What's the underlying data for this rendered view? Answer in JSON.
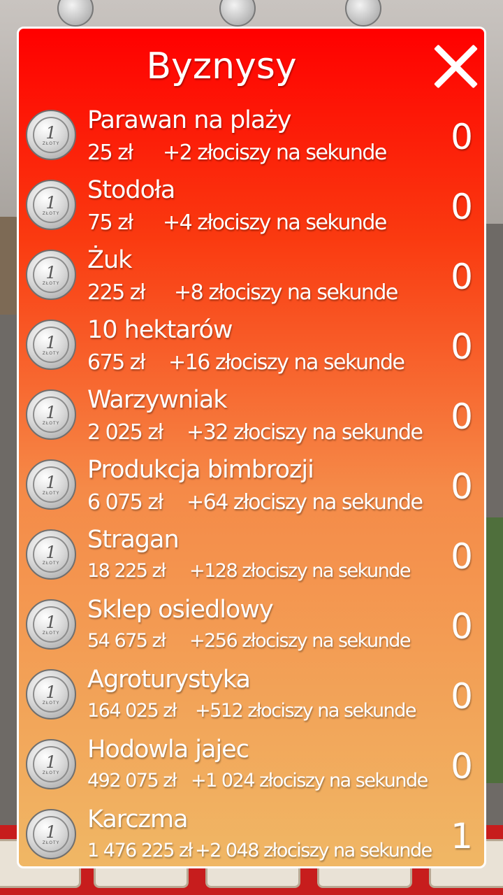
{
  "dialog": {
    "title": "Byznysy",
    "close_icon": "close-icon"
  },
  "coin_label": {
    "num": "1",
    "word": "ZŁOTY"
  },
  "businesses": [
    {
      "name": "Parawan na plaży",
      "price": "25 zł",
      "gain": "+2 złociszy na sekunde",
      "count": "0"
    },
    {
      "name": "Stodoła",
      "price": "75 zł",
      "gain": "+4 złociszy na sekunde",
      "count": "0"
    },
    {
      "name": "Żuk",
      "price": "225 zł",
      "gain": "+8 złociszy na sekunde",
      "count": "0"
    },
    {
      "name": "10 hektarów",
      "price": "675 zł",
      "gain": "+16 złociszy na sekunde",
      "count": "0"
    },
    {
      "name": "Warzywniak",
      "price": "2 025 zł",
      "gain": "+32 złociszy na sekunde",
      "count": "0"
    },
    {
      "name": "Produkcja bimbrozji",
      "price": "6 075 zł",
      "gain": "+64 złociszy na sekunde",
      "count": "0"
    },
    {
      "name": "Stragan",
      "price": "18 225 zł",
      "gain": "+128 złociszy na sekunde",
      "count": "0"
    },
    {
      "name": "Sklep osiedlowy",
      "price": "54 675 zł",
      "gain": "+256 złociszy na sekunde",
      "count": "0"
    },
    {
      "name": "Agroturystyka",
      "price": "164 025 zł",
      "gain": "+512 złociszy na sekunde",
      "count": "0"
    },
    {
      "name": "Hodowla jajec",
      "price": "492 075 zł",
      "gain": "+1 024 złociszy na sekunde",
      "count": "0"
    },
    {
      "name": "Karczma",
      "price": "1 476 225 zł",
      "gain": "+2 048 złociszy na sekunde",
      "count": "1"
    }
  ]
}
